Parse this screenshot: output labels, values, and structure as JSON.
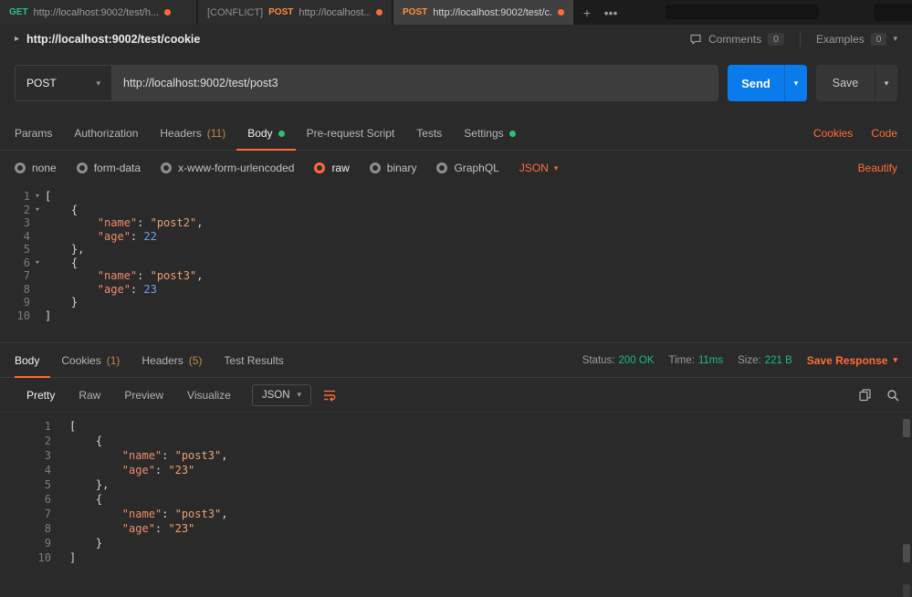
{
  "colors": {
    "accent": "#ff6c37",
    "send_button": "#097bed",
    "success_green": "#17bd7f",
    "method_get": "#2fbf8a",
    "method_post": "#ff8e3d"
  },
  "tab_bar": {
    "tabs": [
      {
        "method": "GET",
        "url": "http://localhost:9002/test/h..."
      },
      {
        "prefix": "[CONFLICT]",
        "method": "POST",
        "url": "http://localhost..."
      },
      {
        "method": "POST",
        "url": "http://localhost:9002/test/c..."
      }
    ],
    "new_tab_label": "+",
    "more_label": "•••"
  },
  "breadcrumb": {
    "title": "http://localhost:9002/test/cookie",
    "comments_label": "Comments",
    "comments_count": "0",
    "examples_label": "Examples",
    "examples_count": "0"
  },
  "request_bar": {
    "method": "POST",
    "url": "http://localhost:9002/test/post3",
    "send_label": "Send",
    "save_label": "Save"
  },
  "request_tabs": {
    "params": "Params",
    "authorization": "Authorization",
    "headers": "Headers",
    "headers_count": "(11)",
    "body": "Body",
    "pre_request_script": "Pre-request Script",
    "tests": "Tests",
    "settings": "Settings",
    "cookies_link": "Cookies",
    "code_link": "Code"
  },
  "body_options": {
    "none": "none",
    "form_data": "form-data",
    "x_www_form_urlencoded": "x-www-form-urlencoded",
    "raw": "raw",
    "binary": "binary",
    "graphql": "GraphQL",
    "format": "JSON",
    "beautify": "Beautify"
  },
  "request_editor": {
    "lines": [
      {
        "num": "1",
        "fold": true,
        "toks": [
          [
            "p",
            "["
          ]
        ]
      },
      {
        "num": "2",
        "fold": true,
        "toks": [
          [
            "p",
            "    {"
          ]
        ]
      },
      {
        "num": "3",
        "toks": [
          [
            "p",
            "        "
          ],
          [
            "k",
            "\"name\""
          ],
          [
            "p",
            ": "
          ],
          [
            "s",
            "\"post2\""
          ],
          [
            "p",
            ","
          ]
        ]
      },
      {
        "num": "4",
        "toks": [
          [
            "p",
            "        "
          ],
          [
            "k",
            "\"age\""
          ],
          [
            "p",
            ": "
          ],
          [
            "n",
            "22"
          ]
        ]
      },
      {
        "num": "5",
        "toks": [
          [
            "p",
            "    },"
          ]
        ]
      },
      {
        "num": "6",
        "fold": true,
        "toks": [
          [
            "p",
            "    {"
          ]
        ]
      },
      {
        "num": "7",
        "toks": [
          [
            "p",
            "        "
          ],
          [
            "k",
            "\"name\""
          ],
          [
            "p",
            ": "
          ],
          [
            "s",
            "\"post3\""
          ],
          [
            "p",
            ","
          ]
        ]
      },
      {
        "num": "8",
        "toks": [
          [
            "p",
            "        "
          ],
          [
            "k",
            "\"age\""
          ],
          [
            "p",
            ": "
          ],
          [
            "n",
            "23"
          ]
        ]
      },
      {
        "num": "9",
        "toks": [
          [
            "p",
            "    }"
          ]
        ]
      },
      {
        "num": "10",
        "toks": [
          [
            "p",
            "]"
          ]
        ]
      }
    ]
  },
  "response": {
    "tabs": {
      "body": "Body",
      "cookies": "Cookies",
      "cookies_count": "(1)",
      "headers": "Headers",
      "headers_count": "(5)",
      "test_results": "Test Results"
    },
    "status_bar": {
      "status_label": "Status:",
      "status_value": "200 OK",
      "time_label": "Time:",
      "time_value": "11ms",
      "size_label": "Size:",
      "size_value": "221 B",
      "save_response_label": "Save Response"
    },
    "toolbar": {
      "pretty": "Pretty",
      "raw": "Raw",
      "preview": "Preview",
      "visualize": "Visualize",
      "format": "JSON"
    },
    "editor": {
      "lines": [
        {
          "num": "1",
          "toks": [
            [
              "p",
              "["
            ]
          ]
        },
        {
          "num": "2",
          "toks": [
            [
              "p",
              "    {"
            ]
          ]
        },
        {
          "num": "3",
          "toks": [
            [
              "p",
              "        "
            ],
            [
              "k",
              "\"name\""
            ],
            [
              "p",
              ": "
            ],
            [
              "s",
              "\"post3\""
            ],
            [
              "p",
              ","
            ]
          ]
        },
        {
          "num": "4",
          "toks": [
            [
              "p",
              "        "
            ],
            [
              "k",
              "\"age\""
            ],
            [
              "p",
              ": "
            ],
            [
              "s",
              "\"23\""
            ]
          ]
        },
        {
          "num": "5",
          "toks": [
            [
              "p",
              "    },"
            ]
          ]
        },
        {
          "num": "6",
          "toks": [
            [
              "p",
              "    {"
            ]
          ]
        },
        {
          "num": "7",
          "toks": [
            [
              "p",
              "        "
            ],
            [
              "k",
              "\"name\""
            ],
            [
              "p",
              ": "
            ],
            [
              "s",
              "\"post3\""
            ],
            [
              "p",
              ","
            ]
          ]
        },
        {
          "num": "8",
          "toks": [
            [
              "p",
              "        "
            ],
            [
              "k",
              "\"age\""
            ],
            [
              "p",
              ": "
            ],
            [
              "s",
              "\"23\""
            ]
          ]
        },
        {
          "num": "9",
          "toks": [
            [
              "p",
              "    }"
            ]
          ]
        },
        {
          "num": "10",
          "toks": [
            [
              "p",
              "]"
            ]
          ]
        }
      ]
    }
  }
}
